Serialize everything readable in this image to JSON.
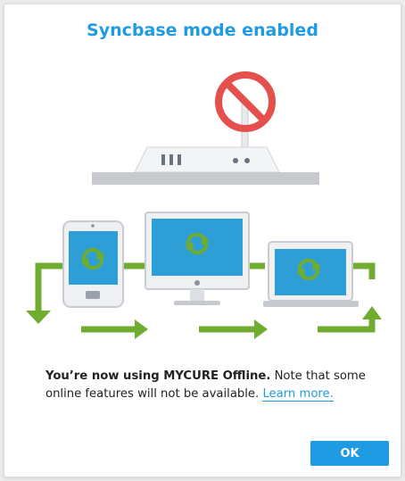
{
  "dialog": {
    "title": "Syncbase mode enabled",
    "message_bold": "You’re now using MYCURE Offline.",
    "message_rest": " Note that some online features will not be available. ",
    "learn_more_label": "Learn more.",
    "ok_label": "OK"
  },
  "colors": {
    "accent": "#1e9be2",
    "arrow_green": "#6fac2f",
    "prohibited_red": "#e4504b",
    "screen_blue": "#2e9fd6"
  },
  "icons": [
    "prohibited-icon",
    "router-icon",
    "phone-icon",
    "monitor-icon",
    "laptop-icon",
    "sync-icon",
    "arrow-icon"
  ]
}
